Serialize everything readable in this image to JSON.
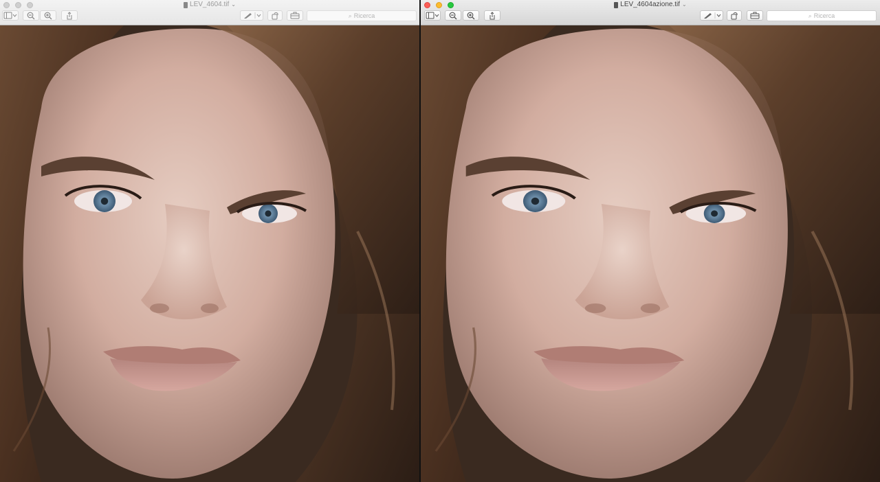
{
  "left_window": {
    "title": "LEV_4604.tif",
    "search_placeholder": "Ricerca",
    "icons": [
      "sidebar-icon",
      "chevron-down-icon",
      "zoom-out-icon",
      "zoom-in-icon",
      "share-icon",
      "markup-pen-icon",
      "rotate-icon",
      "toolbox-icon",
      "search-icon"
    ],
    "image": "portrait photo (original)"
  },
  "right_window": {
    "title": "LEV_4604azione.tif",
    "search_placeholder": "Ricerca",
    "icons": [
      "sidebar-icon",
      "chevron-down-icon",
      "zoom-out-icon",
      "zoom-in-icon",
      "share-icon",
      "markup-pen-icon",
      "rotate-icon",
      "toolbox-icon",
      "search-icon"
    ],
    "image": "portrait photo (retouched)"
  },
  "colors": {
    "close": "#fc5f57",
    "minimize": "#fdbc2e",
    "zoom": "#28c840",
    "skin": "#d9b8ab",
    "hair": "#5a3f2c",
    "eye": "#6f90ab"
  }
}
